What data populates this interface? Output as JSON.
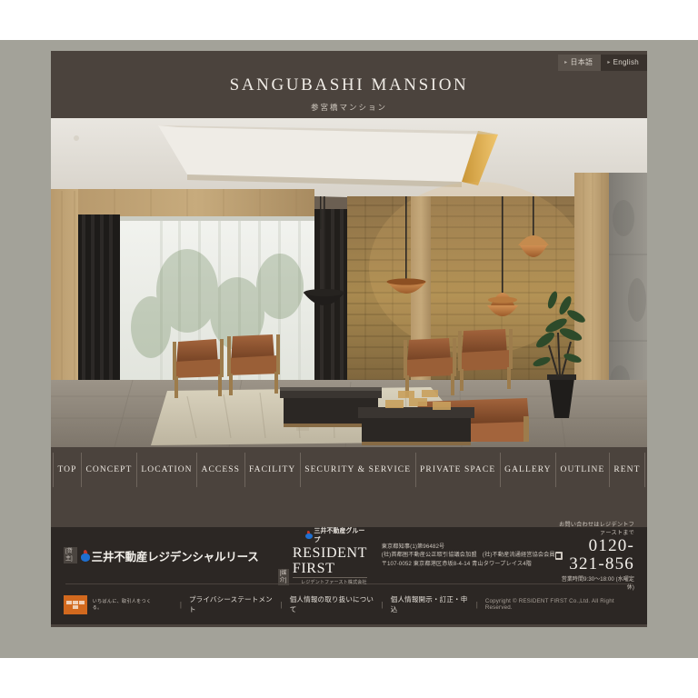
{
  "header": {
    "title": "SANGUBASHI MANSION",
    "subtitle": "参宮橋マンション",
    "lang": {
      "ja": "日本語",
      "en": "English",
      "bullet": "▸"
    }
  },
  "nav": {
    "items": [
      {
        "label": "TOP"
      },
      {
        "label": "CONCEPT"
      },
      {
        "label": "LOCATION"
      },
      {
        "label": "ACCESS"
      },
      {
        "label": "FACILITY"
      },
      {
        "label": "SECURITY & SERVICE"
      },
      {
        "label": "PRIVATE SPACE"
      },
      {
        "label": "GALLERY"
      },
      {
        "label": "OUTLINE"
      },
      {
        "label": "RENT"
      }
    ]
  },
  "hero": {
    "alt": "lounge-interior-photo"
  },
  "footer": {
    "lessor_tag": "[貸主]",
    "lessor_name": "三井不動産レジデンシャルリース",
    "agent_tag": "[媒介]",
    "agent_group": "三井不動産グループ",
    "agent_name": "RESIDENT FIRST",
    "agent_name_sub": "レジデントファースト株式会社",
    "corp_lines": [
      "東京都知事(1)第96482号",
      "(社)首都圏不動産公正取引協議会加盟　(社)不動産流通経営協会会員",
      "〒107-0052 東京都港区赤坂8-4-14 青山タワープレイス4階"
    ],
    "contact_lead": "お問い合わせはレジデントファーストまで",
    "tel": "0120-321-856",
    "hours": "営業時間9:30〜18:00 (水曜定休)",
    "eco_text": "いちばんに、取引人をつくる。",
    "links": [
      {
        "label": "プライバシーステートメント"
      },
      {
        "label": "個人情報の取り扱いについて"
      },
      {
        "label": "個人情報開示・訂正・申込"
      }
    ],
    "link_separator": "|",
    "copyright": "Copyright © RESIDENT FIRST Co.,Ltd. All Right Reserved."
  },
  "colors": {
    "page_bg": "#a3a299",
    "site_bg": "#4b433d",
    "footer_bg": "#2c2724",
    "accent_orange": "#d2691e",
    "text_light": "#f0ece6"
  }
}
